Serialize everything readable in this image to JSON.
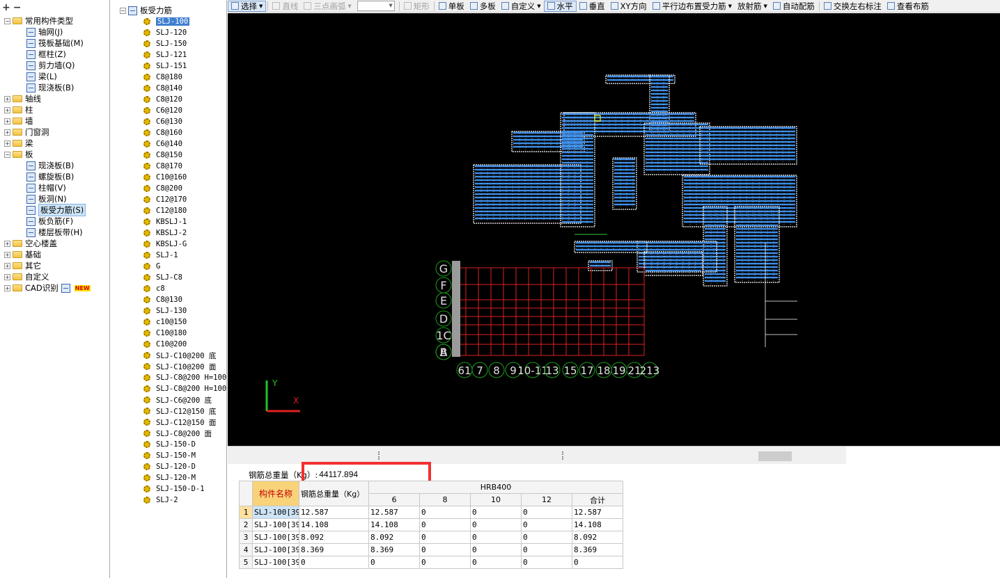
{
  "left_panel": {
    "toolbar": {
      "expand_all": "+",
      "collapse_all": "−"
    },
    "tree": [
      {
        "label": "常用构件类型",
        "level": 0,
        "type": "folder",
        "expanded": true
      },
      {
        "label": "轴网(J)",
        "level": 1,
        "type": "icon"
      },
      {
        "label": "筏板基础(M)",
        "level": 1,
        "type": "icon"
      },
      {
        "label": "框柱(Z)",
        "level": 1,
        "type": "icon"
      },
      {
        "label": "剪力墙(Q)",
        "level": 1,
        "type": "icon"
      },
      {
        "label": "梁(L)",
        "level": 1,
        "type": "icon"
      },
      {
        "label": "现浇板(B)",
        "level": 1,
        "type": "icon"
      },
      {
        "label": "轴线",
        "level": 0,
        "type": "folder",
        "expanded": false
      },
      {
        "label": "柱",
        "level": 0,
        "type": "folder",
        "expanded": false
      },
      {
        "label": "墙",
        "level": 0,
        "type": "folder",
        "expanded": false
      },
      {
        "label": "门窗洞",
        "level": 0,
        "type": "folder",
        "expanded": false
      },
      {
        "label": "梁",
        "level": 0,
        "type": "folder",
        "expanded": false
      },
      {
        "label": "板",
        "level": 0,
        "type": "folder",
        "expanded": true
      },
      {
        "label": "现浇板(B)",
        "level": 1,
        "type": "icon"
      },
      {
        "label": "螺旋板(B)",
        "level": 1,
        "type": "icon"
      },
      {
        "label": "柱帽(V)",
        "level": 1,
        "type": "icon"
      },
      {
        "label": "板洞(N)",
        "level": 1,
        "type": "icon"
      },
      {
        "label": "板受力筋(S)",
        "level": 1,
        "type": "icon",
        "selected": true
      },
      {
        "label": "板负筋(F)",
        "level": 1,
        "type": "icon"
      },
      {
        "label": "楼层板带(H)",
        "level": 1,
        "type": "icon"
      },
      {
        "label": "空心楼盖",
        "level": 0,
        "type": "folder",
        "expanded": false
      },
      {
        "label": "基础",
        "level": 0,
        "type": "folder",
        "expanded": false
      },
      {
        "label": "其它",
        "level": 0,
        "type": "folder",
        "expanded": false
      },
      {
        "label": "自定义",
        "level": 0,
        "type": "folder",
        "expanded": false
      },
      {
        "label": "CAD识别",
        "level": 0,
        "type": "folder",
        "expanded": false,
        "badge": "NEW"
      }
    ]
  },
  "list_panel": {
    "root_label": "板受力筋",
    "items": [
      "SLJ-100",
      "SLJ-120",
      "SLJ-150",
      "SLJ-121",
      "SLJ-151",
      "C8@180",
      "C8@140",
      "C8@120",
      "C6@120",
      "C6@130",
      "C8@160",
      "C6@140",
      "C8@150",
      "C8@170",
      "C10@160",
      "C8@200",
      "C12@170",
      "C12@180",
      "KBSLJ-1",
      "KBSLJ-2",
      "KBSLJ-G",
      "SLJ-1",
      "G",
      "SLJ-C8",
      "c8",
      "C8@130",
      "SLJ-130",
      "c10@150",
      "C10@180",
      "C10@200",
      "SLJ-C10@200 底",
      "SLJ-C10@200 面",
      "SLJ-C8@200 H=100]",
      "SLJ-C8@200 H=100]",
      "SLJ-C6@200 底",
      "SLJ-C12@150 底",
      "SLJ-C12@150 面",
      "SLJ-C8@200 面",
      "SLJ-150-D",
      "SLJ-150-M",
      "SLJ-120-D",
      "SLJ-120-M",
      "SLJ-150-D-1",
      "SLJ-2"
    ],
    "selected_index": 0
  },
  "toolbar": {
    "select": "选择",
    "line": "直线",
    "arc": "三点画弧",
    "rect": "矩形",
    "single_board": "单板",
    "multi_board": "多板",
    "custom": "自定义",
    "horizontal": "水平",
    "vertical": "垂直",
    "xy_direction": "XY方向",
    "parallel_edge": "平行边布置受力筋",
    "radial": "放射筋",
    "auto_config": "自动配筋",
    "swap_labels": "交换左右标注",
    "view_layout": "查看布筋"
  },
  "canvas": {
    "axis_labels": {
      "y": "Y",
      "x": "X"
    },
    "grid_rows": [
      "G",
      "F",
      "E",
      "D",
      "1C",
      "A",
      "B"
    ],
    "grid_cols": [
      "61",
      "7",
      "8",
      "9",
      "10-11",
      "13",
      "15",
      "17",
      "18",
      "19",
      "21",
      "213"
    ],
    "colors": {
      "background": "#000000",
      "rebar": "#3c8ce6",
      "outline": "#ffffff",
      "grid": "#e02020",
      "axis_bubble": "#1a9e1a"
    }
  },
  "bottom": {
    "total_label": "钢筋总重量（Kg）:",
    "total_value": "44117.894",
    "table": {
      "header_name": "构件名称",
      "header_total": "钢筋总重量（Kg）",
      "group_header": "HRB400",
      "diameters": [
        "6",
        "8",
        "10",
        "12"
      ],
      "sum_header": "合计",
      "rows": [
        {
          "n": "1",
          "name": "SLJ-100[39",
          "total": "12.587",
          "d6": "12.587",
          "d8": "0",
          "d10": "0",
          "d12": "0",
          "sum": "12.587"
        },
        {
          "n": "2",
          "name": "SLJ-100[39",
          "total": "14.108",
          "d6": "14.108",
          "d8": "0",
          "d10": "0",
          "d12": "0",
          "sum": "14.108"
        },
        {
          "n": "3",
          "name": "SLJ-100[39",
          "total": "8.092",
          "d6": "8.092",
          "d8": "0",
          "d10": "0",
          "d12": "0",
          "sum": "8.092"
        },
        {
          "n": "4",
          "name": "SLJ-100[39",
          "total": "8.369",
          "d6": "8.369",
          "d8": "0",
          "d10": "0",
          "d12": "0",
          "sum": "8.369"
        },
        {
          "n": "5",
          "name": "SLJ-100[39",
          "total": "0",
          "d6": "0",
          "d8": "0",
          "d10": "0",
          "d12": "0",
          "sum": "0"
        }
      ]
    }
  }
}
